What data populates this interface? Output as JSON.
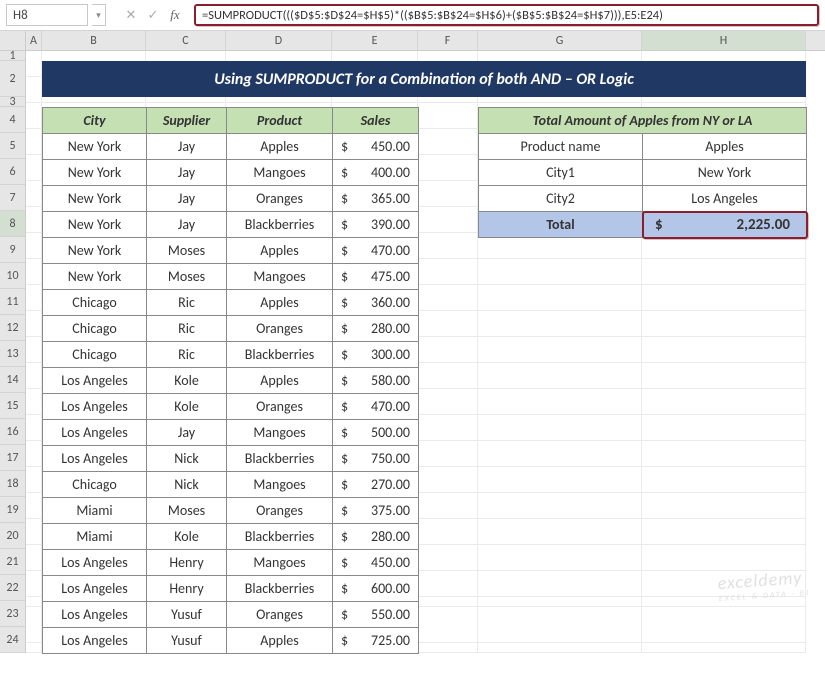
{
  "nameBox": "H8",
  "formulaBar": "=SUMPRODUCT((($D$5:$D$24=$H$5)*(($B$5:$B$24=$H$6)+($B$5:$B$24=$H$7))),E5:E24)",
  "icons": {
    "dropdown": "▾",
    "cancel": "✕",
    "check": "✓",
    "fx": "fx"
  },
  "columns": [
    "A",
    "B",
    "C",
    "D",
    "E",
    "F",
    "G",
    "H"
  ],
  "rows": [
    "1",
    "2",
    "3",
    "4",
    "5",
    "6",
    "7",
    "8",
    "9",
    "10",
    "11",
    "12",
    "13",
    "14",
    "15",
    "16",
    "17",
    "18",
    "19",
    "20",
    "21",
    "22",
    "23",
    "24"
  ],
  "selectedCol": "H",
  "selectedRow": "8",
  "title": "Using SUMPRODUCT for a Combination of both AND – OR Logic",
  "mainTable": {
    "headers": [
      "City",
      "Supplier",
      "Product",
      "Sales"
    ],
    "rows": [
      [
        "New York",
        "Jay",
        "Apples",
        "450.00"
      ],
      [
        "New York",
        "Jay",
        "Mangoes",
        "400.00"
      ],
      [
        "New York",
        "Jay",
        "Oranges",
        "365.00"
      ],
      [
        "New York",
        "Jay",
        "Blackberries",
        "390.00"
      ],
      [
        "New York",
        "Moses",
        "Apples",
        "470.00"
      ],
      [
        "New York",
        "Moses",
        "Mangoes",
        "475.00"
      ],
      [
        "Chicago",
        "Ric",
        "Apples",
        "360.00"
      ],
      [
        "Chicago",
        "Ric",
        "Oranges",
        "280.00"
      ],
      [
        "Chicago",
        "Ric",
        "Blackberries",
        "300.00"
      ],
      [
        "Los Angeles",
        "Kole",
        "Apples",
        "580.00"
      ],
      [
        "Los Angeles",
        "Kole",
        "Oranges",
        "470.00"
      ],
      [
        "Los Angeles",
        "Jay",
        "Mangoes",
        "500.00"
      ],
      [
        "Los Angeles",
        "Nick",
        "Blackberries",
        "750.00"
      ],
      [
        "Chicago",
        "Nick",
        "Mangoes",
        "270.00"
      ],
      [
        "Miami",
        "Moses",
        "Oranges",
        "375.00"
      ],
      [
        "Miami",
        "Kole",
        "Blackberries",
        "280.00"
      ],
      [
        "Los Angeles",
        "Henry",
        "Mangoes",
        "450.00"
      ],
      [
        "Los Angeles",
        "Henry",
        "Blackberries",
        "600.00"
      ],
      [
        "Los Angeles",
        "Yusuf",
        "Oranges",
        "550.00"
      ],
      [
        "Los Angeles",
        "Yusuf",
        "Apples",
        "725.00"
      ]
    ]
  },
  "sideTable": {
    "header": "Total Amount of Apples from NY or LA",
    "rows": [
      [
        "Product name",
        "Apples"
      ],
      [
        "City1",
        "New York"
      ],
      [
        "City2",
        "Los Angeles"
      ]
    ],
    "totalLabel": "Total",
    "totalValue": "2,225.00"
  },
  "currency": "$",
  "watermark": "exceldemy",
  "watermarkSub": "EXCEL & DATA - BI"
}
